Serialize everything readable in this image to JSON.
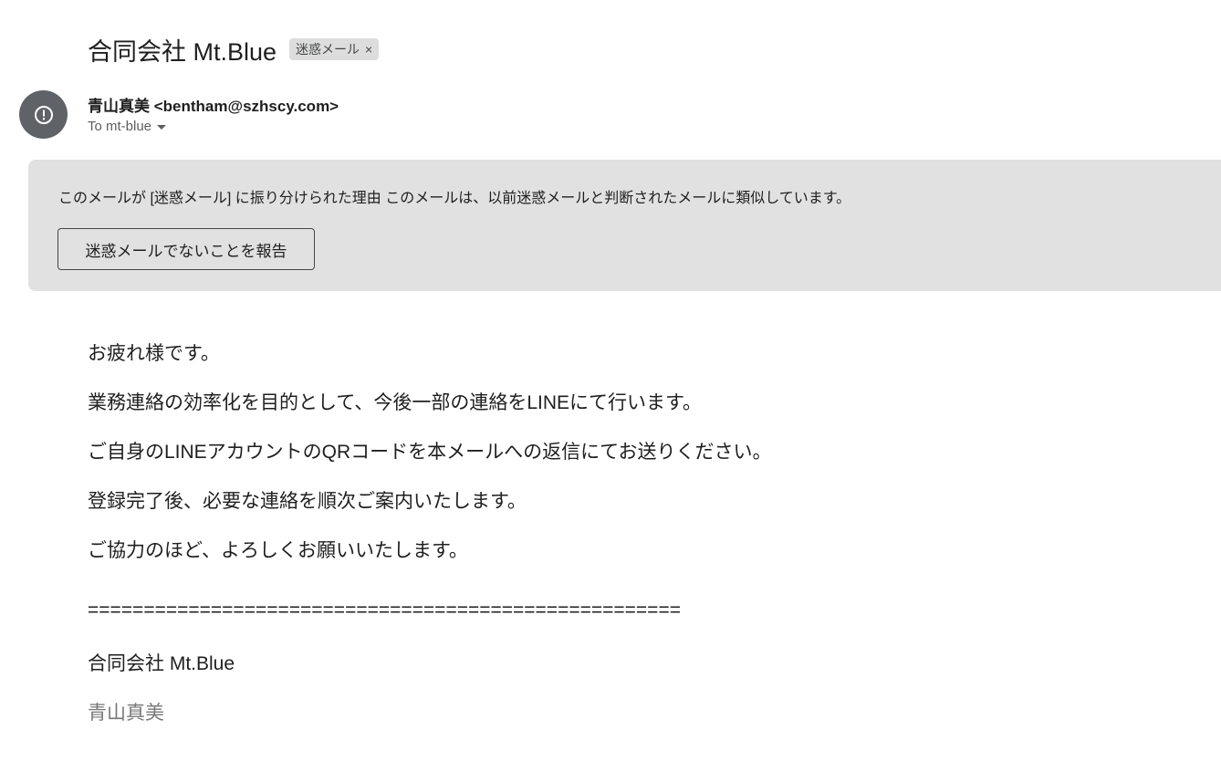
{
  "header": {
    "subject": "合同会社 Mt.Blue",
    "label_chip": "迷惑メール",
    "label_close": "×"
  },
  "sender": {
    "display": "青山真美 <bentham@szhscy.com>",
    "recipients": "To mt-blue",
    "avatar_icon": "warning-icon"
  },
  "spam_banner": {
    "reason": "このメールが [迷惑メール] に振り分けられた理由 このメールは、以前迷惑メールと判断されたメールに類似しています。",
    "button_label": "迷惑メールでないことを報告"
  },
  "body": {
    "lines": [
      "お疲れ様です。",
      "業務連絡の効率化を目的として、今後一部の連絡をLINEにて行います。",
      "ご自身のLINEアカウントのQRコードを本メールへの返信にてお送りください。",
      "登録完了後、必要な連絡を順次ご案内いたします。",
      "ご協力のほど、よろしくお願いいたします。"
    ],
    "separator": "=====================================================",
    "signature_company": "合同会社 Mt.Blue",
    "signature_name": "青山真美"
  },
  "colors": {
    "banner_bg": "#e1e1e1",
    "avatar_bg": "#5f6368",
    "chip_bg": "#dddddd"
  }
}
